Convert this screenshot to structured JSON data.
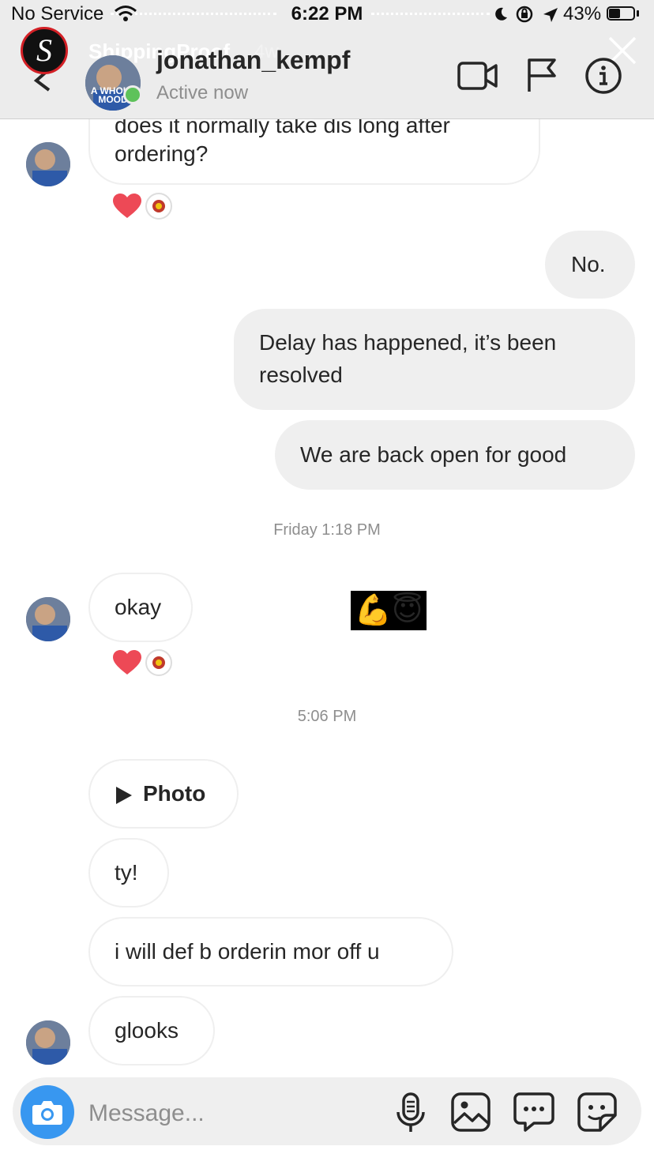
{
  "status_bar": {
    "carrier": "No Service",
    "time": "6:22 PM",
    "battery": "43%"
  },
  "story": {
    "account": "ShippingProof",
    "age": "4w",
    "logo_letter": "S"
  },
  "header": {
    "username": "jonathan_kempf",
    "status": "Active now",
    "avatar_text": "A WHOLE MOOD"
  },
  "messages": {
    "m1_partial": "does it normally take dis long after",
    "m1": "ordering?",
    "m2": "No.",
    "m3_line1": "Delay has happened, it’s been",
    "m3_line2": "resolved",
    "m4": "We are back open for good",
    "ts1": "Friday 1:18 PM",
    "m5": "okay",
    "sticker": "💪😇",
    "ts2": "5:06 PM",
    "m6": "Photo",
    "m7": "ty!",
    "m8": "i will def b orderin mor off u",
    "m9": "glooks"
  },
  "composer": {
    "placeholder": "Message..."
  },
  "colors": {
    "accent": "#3897f0",
    "heart": "#ed4956",
    "active": "#5ec25a",
    "brand_red": "#d32026"
  }
}
